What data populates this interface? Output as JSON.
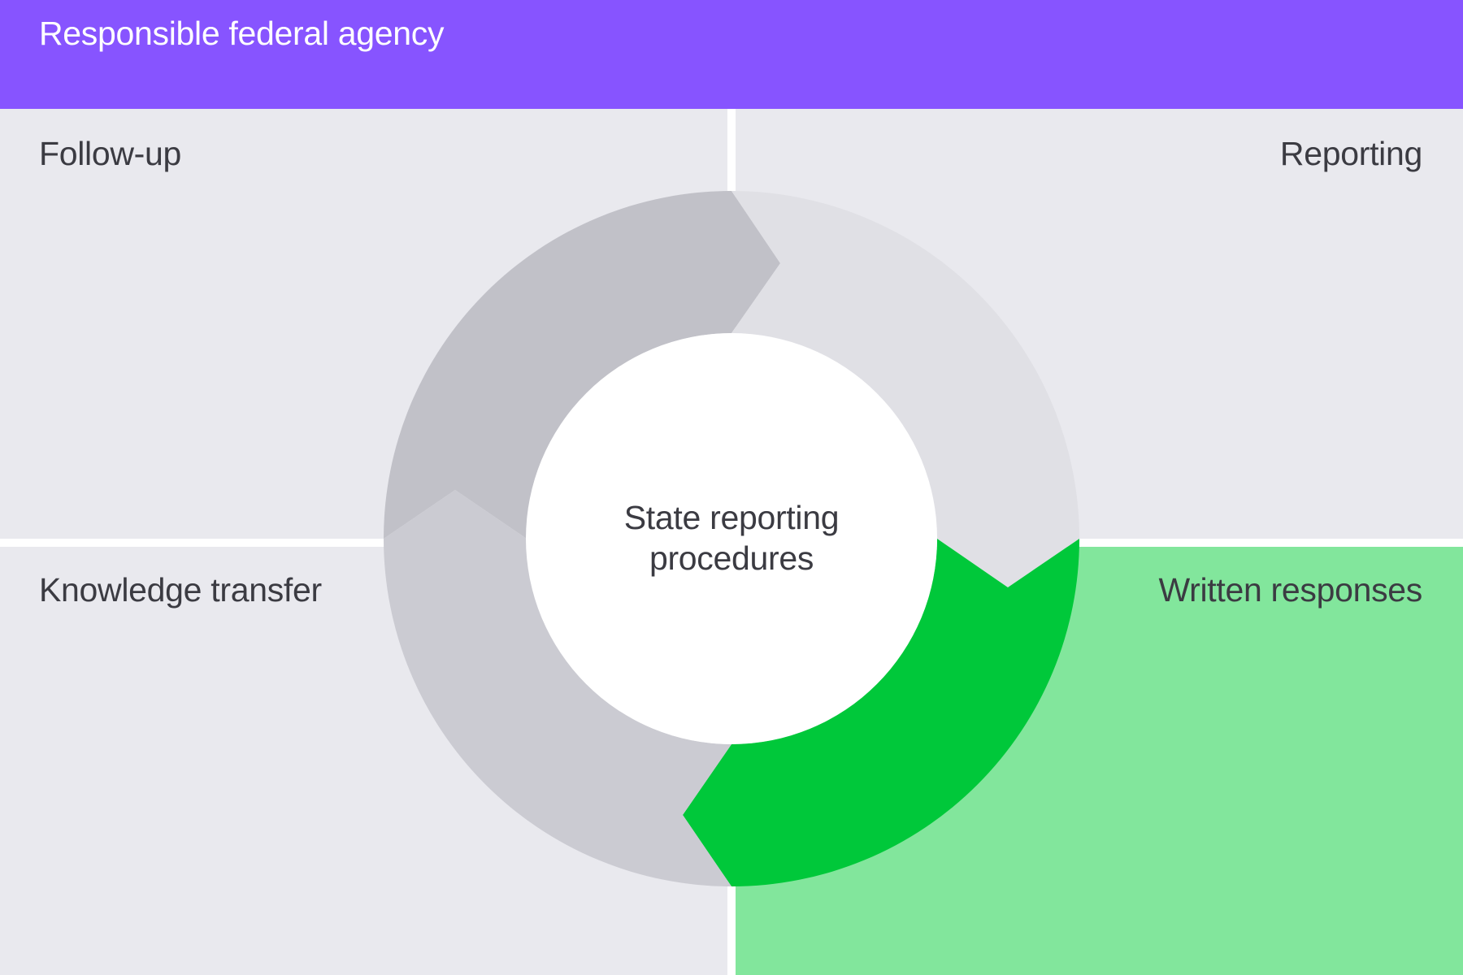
{
  "header": {
    "title": "Responsible federal agency"
  },
  "quadrants": {
    "top_left": {
      "label": "Follow-up",
      "color": "#e9e9ee"
    },
    "top_right": {
      "label": "Reporting",
      "color": "#e9e9ee"
    },
    "bottom_left": {
      "label": "Knowledge transfer",
      "color": "#e9e9ee"
    },
    "bottom_right": {
      "label": "Written responses",
      "color": "#82e69c",
      "highlighted": true
    }
  },
  "center": {
    "line1": "State reporting",
    "line2": "procedures"
  },
  "colors": {
    "header": "#8754ff",
    "arrow_follow_up": "#c1c1c8",
    "arrow_reporting": "#e0e0e5",
    "arrow_written_responses": "#00c83a",
    "arrow_knowledge_transfer": "#cbcbd2",
    "text": "#3b3b42"
  }
}
